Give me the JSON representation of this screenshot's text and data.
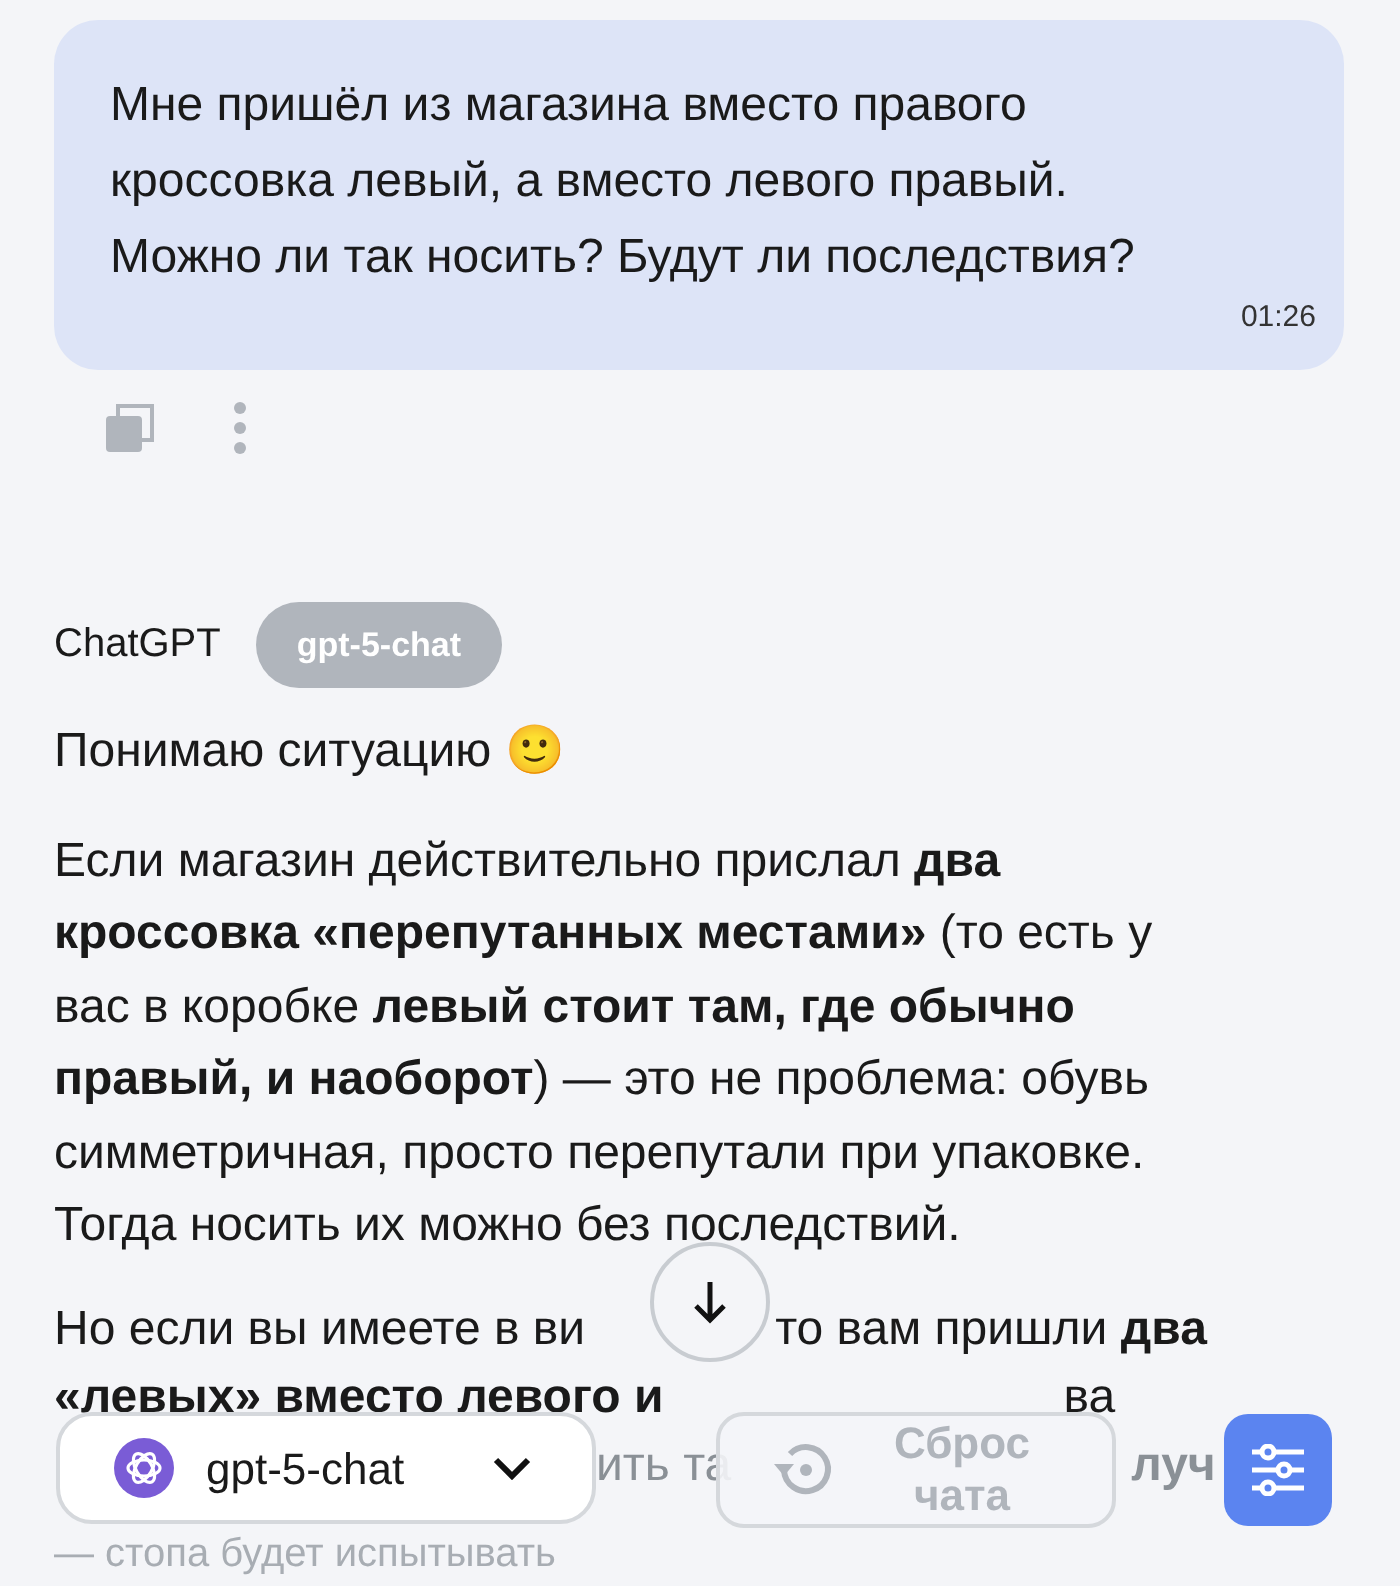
{
  "user_message": {
    "text": "Мне пришёл из магазина вместо правого кроссовка левый, а вместо левого правый. Можно ли так носить? Будут ли последствия?",
    "time": "01:26"
  },
  "assistant": {
    "name": "ChatGPT",
    "model_badge": "gpt-5-chat",
    "paragraphs": [
      "Понимаю ситуацию 🙂",
      "Если магазин действительно прислал **два кроссовка «перепутанных местами»** (то есть у вас в коробке **левый стоит там, где обычно правый, и наоборот**) — это не проблема: обувь симметричная, просто перепутали при упаковке. Тогда носить их можно без последствий."
    ],
    "partial_lines": [
      [
        "Но если вы имеете в ви",
        "то вам пришли **два**"
      ],
      [
        "**«левых» вместо левого и**",
        "ва"
      ],
      [
        "ить та",
        "**луч**"
      ],
      [
        "— стопа будет испытывать"
      ]
    ]
  },
  "model_selector": {
    "label": "gpt-5-chat"
  },
  "reset_button": {
    "label": "Сброс чата",
    "disabled": true
  }
}
